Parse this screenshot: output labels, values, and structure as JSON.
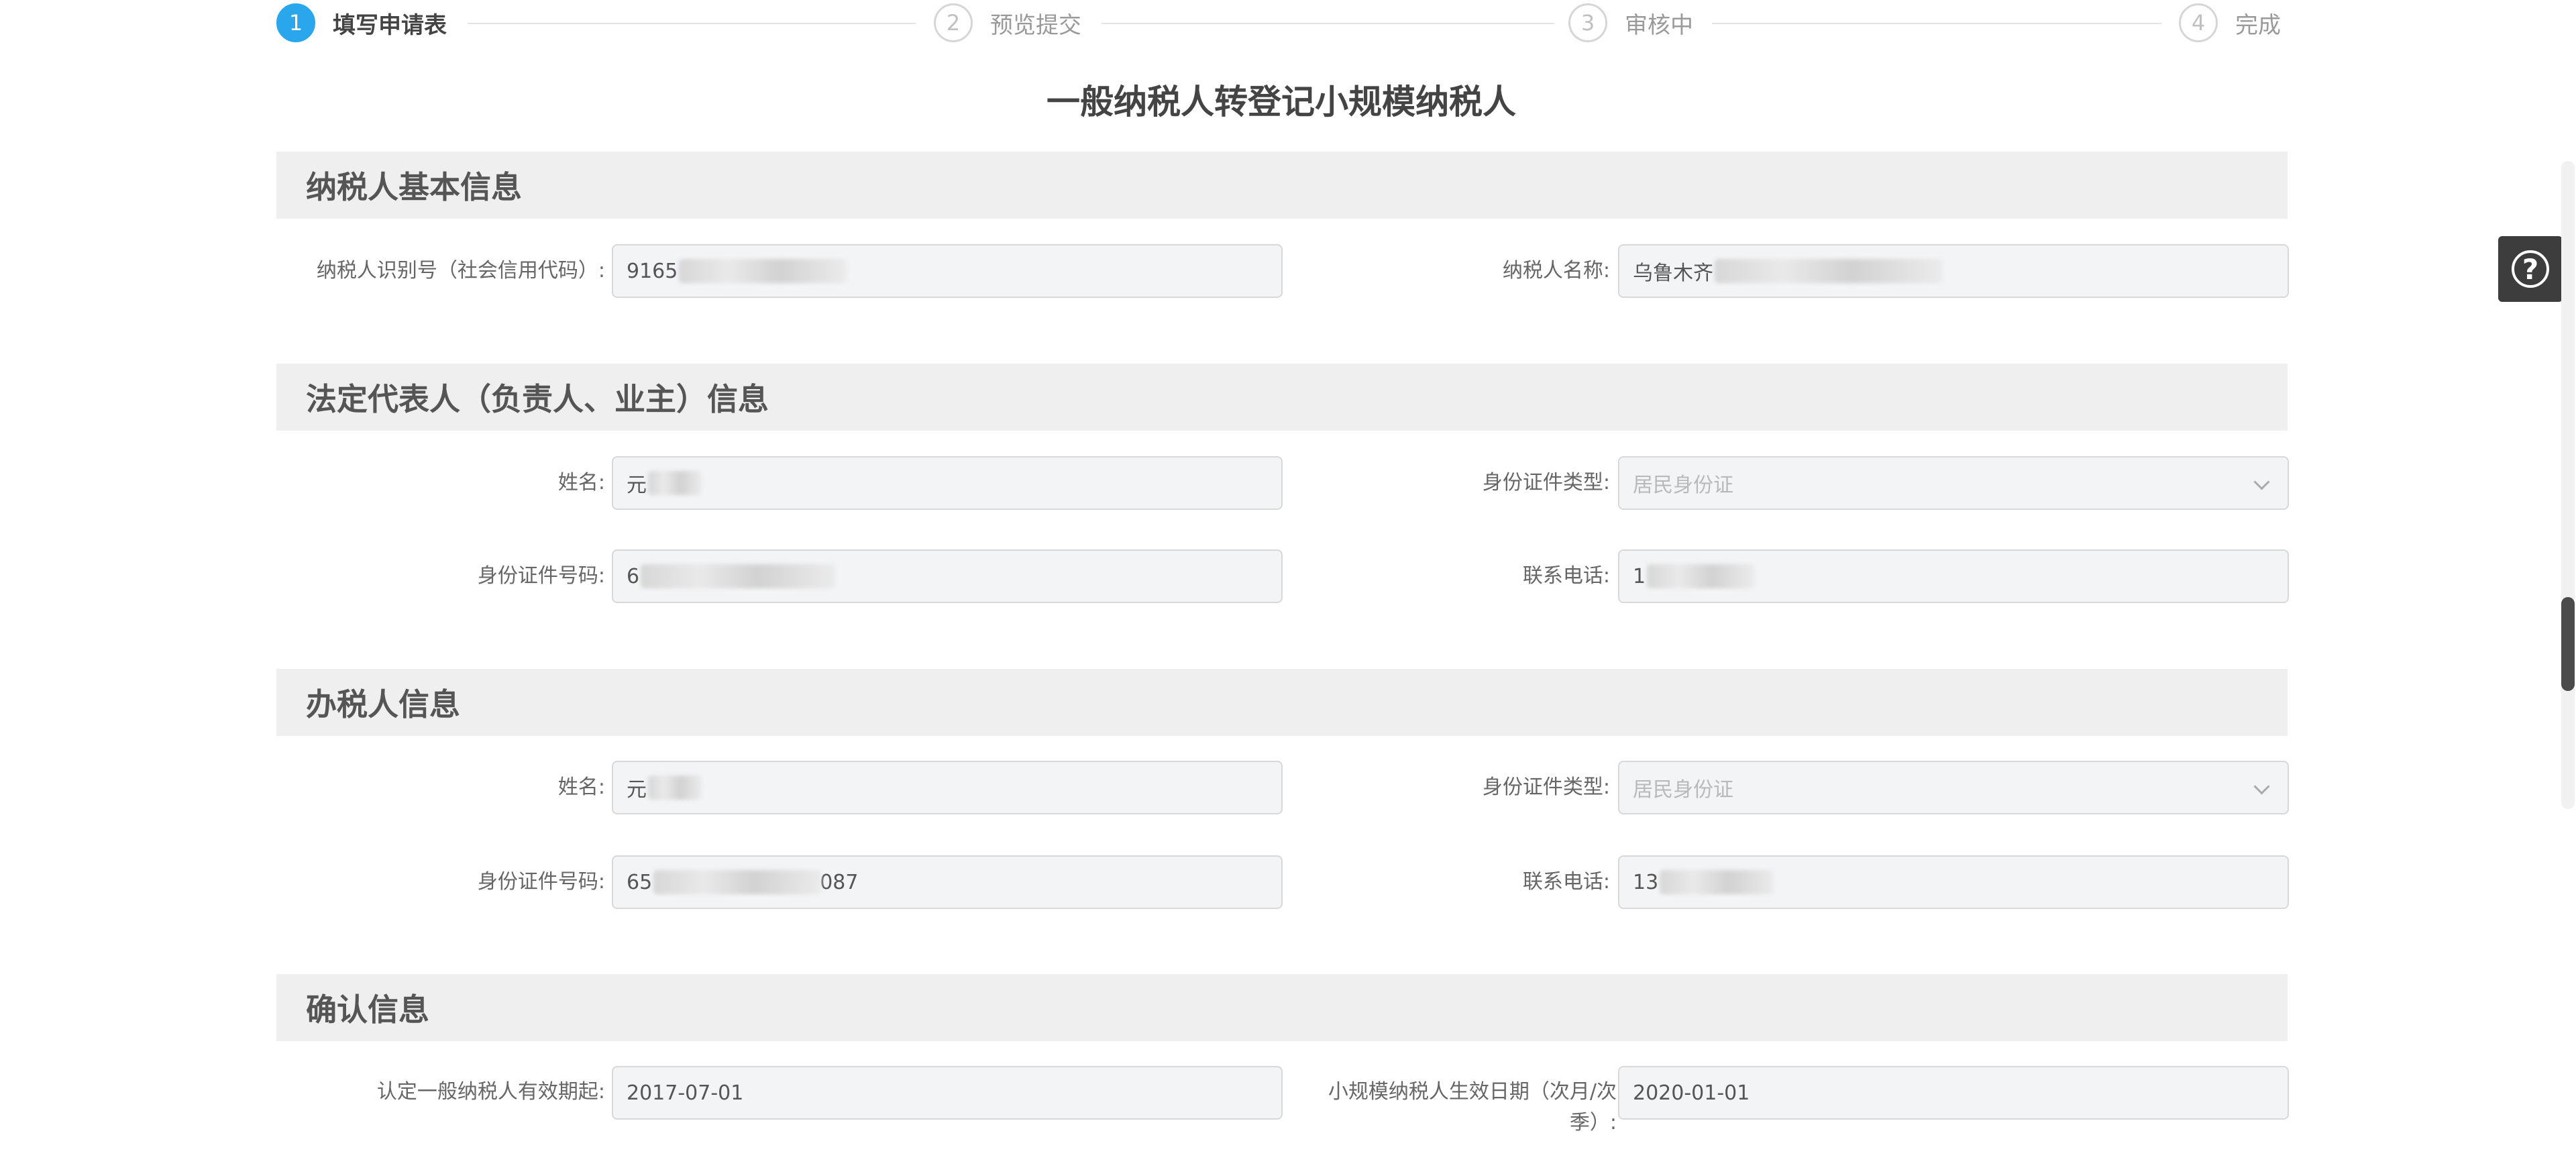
{
  "steps": [
    {
      "number": "1",
      "label": "填写申请表"
    },
    {
      "number": "2",
      "label": "预览提交"
    },
    {
      "number": "3",
      "label": "审核中"
    },
    {
      "number": "4",
      "label": "完成"
    }
  ],
  "title": "一般纳税人转登记小规模纳税人",
  "sections": {
    "basic": {
      "header": "纳税人基本信息",
      "taxpayer_id_label": "纳税人识别号（社会信用代码）:",
      "taxpayer_id_value": "9165",
      "taxpayer_name_label": "纳税人名称:",
      "taxpayer_name_value": "乌鲁木齐"
    },
    "legal": {
      "header": "法定代表人（负责人、业主）信息",
      "name_label": "姓名:",
      "name_value": "元",
      "id_type_label": "身份证件类型:",
      "id_type_value": "居民身份证",
      "id_number_label": "身份证件号码:",
      "id_number_value": "6",
      "phone_label": "联系电话:",
      "phone_value": "1"
    },
    "agent": {
      "header": "办税人信息",
      "name_label": "姓名:",
      "name_value": "元",
      "id_type_label": "身份证件类型:",
      "id_type_value": "居民身份证",
      "id_number_label": "身份证件号码:",
      "id_number_value": "65",
      "id_number_tail": "087",
      "phone_label": "联系电话:",
      "phone_value": "13"
    },
    "confirm": {
      "header": "确认信息",
      "general_start_label": "认定一般纳税人有效期起:",
      "general_start_value": "2017-07-01",
      "small_effective_label": "小规模纳税人生效日期（次月/次季）:",
      "small_effective_value": "2020-01-01"
    }
  },
  "help_icon": "question-circle-icon"
}
